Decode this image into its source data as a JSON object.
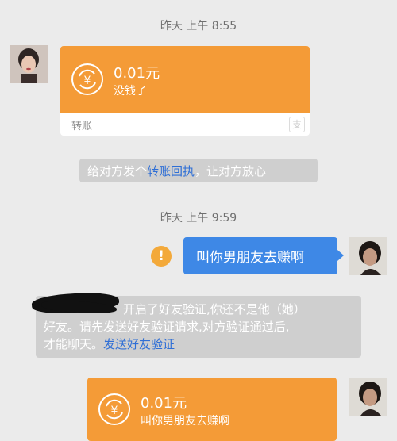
{
  "timestamps": [
    "昨天 上午 8:55",
    "昨天 上午 9:59"
  ],
  "transfer_received": {
    "amount": "0.01元",
    "note": "没钱了",
    "label": "转账"
  },
  "system_tip": {
    "prefix": "给对方发个",
    "link": "转账回执",
    "suffix": "，让对方放心"
  },
  "sent_message": {
    "text": "叫你男朋友去赚啊",
    "warning_glyph": "!"
  },
  "friend_verify": {
    "visible_text": "开启了好友验证,你还不是他（她）",
    "line2": "好友。请先发送好友验证请求,对方验证通过后,",
    "line3_prefix": "才能聊天。",
    "link": "发送好友验证"
  },
  "transfer_sent": {
    "amount": "0.01元",
    "note": "叫你男朋友去赚啊"
  },
  "icons": {
    "transfer": "yuan-exchange-icon",
    "alipay_watermark": "alipay-icon",
    "warning": "exclamation-icon"
  },
  "colors": {
    "transfer_orange": "#f49b37",
    "sent_bubble": "#3e88e6",
    "link": "#2f6fd6",
    "warning": "#f3a93a"
  }
}
